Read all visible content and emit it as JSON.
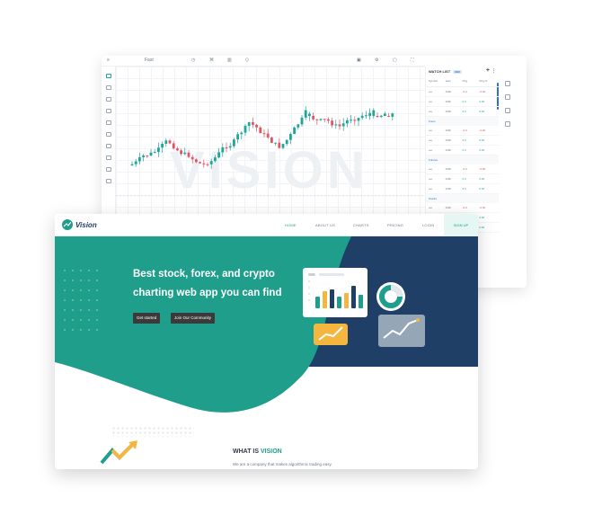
{
  "app": {
    "toolbar": {
      "symbol": "Fast",
      "menu_icon": "menu-icon"
    },
    "watermark": "VISION",
    "watchlist": {
      "title": "WATCH LIST",
      "badge": "DEF",
      "add_icon": "plus-icon",
      "columns": [
        "Symbol",
        "Last",
        "Chg",
        "Chg %"
      ],
      "groups": [
        {
          "name": "",
          "rows": [
            [
              "••••",
              "0.00",
              "-0.0",
              "-0.00"
            ],
            [
              "••••",
              "0.00",
              "0.0",
              "0.00"
            ],
            [
              "••••",
              "0.00",
              "0.0",
              "0.00"
            ]
          ]
        },
        {
          "name": "Forex",
          "rows": [
            [
              "••••",
              "0.00",
              "-0.0",
              "-0.00"
            ],
            [
              "••••",
              "0.00",
              "0.0",
              "0.00"
            ],
            [
              "••••",
              "0.00",
              "0.0",
              "0.00"
            ]
          ]
        },
        {
          "name": "Futures",
          "rows": [
            [
              "••••",
              "0.00",
              "-0.0",
              "-0.00"
            ],
            [
              "••••",
              "0.00",
              "0.0",
              "0.00"
            ],
            [
              "••••",
              "0.00",
              "0.0",
              "0.00"
            ]
          ]
        },
        {
          "name": "Stocks",
          "rows": [
            [
              "••••",
              "0.00",
              "-0.0",
              "-0.00"
            ],
            [
              "••••",
              "0.00",
              "0.0",
              "0.00"
            ],
            [
              "••••",
              "0.00",
              "0.0",
              "0.00"
            ]
          ]
        }
      ]
    },
    "colors": {
      "up": "#1fa69a",
      "down": "#e25563"
    }
  },
  "site": {
    "logo_text": "Vision",
    "nav": {
      "home": "HOME",
      "about": "ABOUT US",
      "charts": "CHARTS",
      "pricing": "PRICING",
      "login": "LOGIN",
      "signup": "SIGN UP"
    },
    "hero": {
      "title_line1": "Best stock, forex, and crypto",
      "title_line2": "charting web app you can find",
      "btn_primary": "Get started",
      "btn_secondary": "Join Our Community"
    },
    "what_is": {
      "prefix": "WHAT IS ",
      "brand": "VISION",
      "subtitle": "We are a company that makes algorithmic trading easy."
    },
    "colors": {
      "teal": "#1f9e8b",
      "navy": "#1f3f66",
      "orange": "#f5b640"
    }
  }
}
